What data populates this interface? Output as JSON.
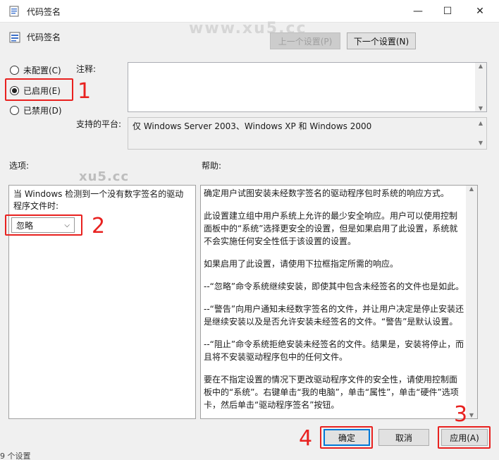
{
  "window": {
    "title": "代码签名",
    "minimize": "—",
    "maximize": "☐",
    "close": "✕"
  },
  "policy": {
    "name": "代码签名"
  },
  "watermarks": [
    "www.xu5.cc",
    "xu5.cc"
  ],
  "nav": {
    "prev": "上一个设置(P)",
    "next": "下一个设置(N)"
  },
  "radios": [
    {
      "label": "未配置(C)",
      "checked": false
    },
    {
      "label": "已启用(E)",
      "checked": true
    },
    {
      "label": "已禁用(D)",
      "checked": false
    }
  ],
  "comment": {
    "label": "注释:",
    "value": ""
  },
  "platform": {
    "label": "支持的平台:",
    "value": "仅 Windows Server 2003、Windows XP 和 Windows 2000"
  },
  "options": {
    "header": "选项:",
    "text": "当 Windows 检测到一个没有数字签名的驱动程序文件时:",
    "select_value": "忽略"
  },
  "help": {
    "header": "帮助:",
    "paragraphs": [
      "确定用户试图安装未经数字签名的驱动程序包时系统的响应方式。",
      "此设置建立组中用户系统上允许的最少安全响应。用户可以使用控制面板中的“系统”选择更安全的设置，但是如果启用了此设置，系统就不会实施任何安全性低于该设置的设置。",
      "如果启用了此设置，请使用下拉框指定所需的响应。",
      "--“忽略”命令系统继续安装，即使其中包含未经签名的文件也是如此。",
      "--“警告”向用户通知未经数字签名的文件，并让用户决定是停止安装还是继续安装以及是否允许安装未经签名的文件。“警告”是默认设置。",
      "--“阻止”命令系统拒绝安装未经签名的文件。结果是，安装将停止，而且将不安装驱动程序包中的任何文件。",
      "要在不指定设置的情况下更改驱动程序文件的安全性，请使用控制面板中的“系统”。右键单击“我的电脑”，单击“属性”，单击“硬件”选项卡，然后单击“驱动程序签名”按钮。"
    ]
  },
  "buttons": {
    "ok": "确定",
    "cancel": "取消",
    "apply": "应用(A)"
  },
  "annotations": [
    "1",
    "2",
    "3",
    "4"
  ],
  "status": "9 个设置"
}
